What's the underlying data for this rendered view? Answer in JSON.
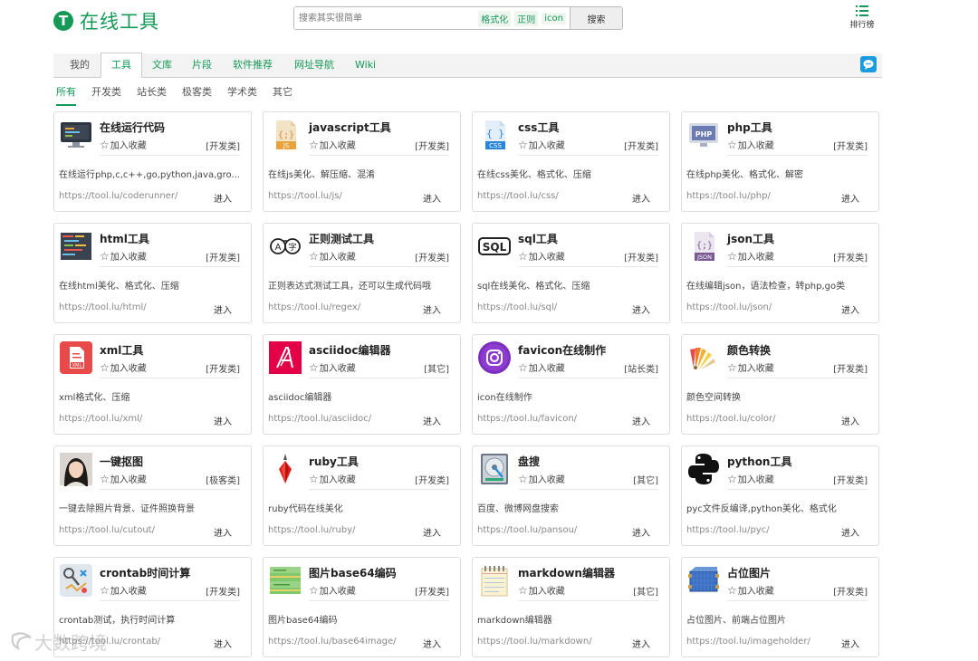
{
  "header": {
    "logo_letter": "T",
    "logo_text": "在线工具",
    "search_placeholder": "搜索其实很简单",
    "search_tags": [
      "格式化",
      "正则",
      "icon"
    ],
    "search_button": "搜索",
    "rank_label": "排行榜"
  },
  "nav": {
    "tabs": [
      "我的",
      "工具",
      "文库",
      "片段",
      "软件推荐",
      "网址导航",
      "Wiki"
    ],
    "active": "工具"
  },
  "subtabs": [
    "所有",
    "开发类",
    "站长类",
    "极客类",
    "学术类",
    "其它"
  ],
  "fav_label": "加入收藏",
  "enter_label": "进入",
  "cards": [
    {
      "title": "在线运行代码",
      "category": "[开发类]",
      "desc": "在线运行php,c,c++,go,python,java,gro...",
      "url": "https://tool.lu/coderunner/",
      "icon": "monitor-code-icon"
    },
    {
      "title": "javascript工具",
      "category": "[开发类]",
      "desc": "在线js美化、解压缩、混淆",
      "url": "https://tool.lu/js/",
      "icon": "js-file-icon"
    },
    {
      "title": "css工具",
      "category": "[开发类]",
      "desc": "在线css美化、格式化、压缩",
      "url": "https://tool.lu/css/",
      "icon": "css-file-icon"
    },
    {
      "title": "php工具",
      "category": "[开发类]",
      "desc": "在线php美化、格式化、解密",
      "url": "https://tool.lu/php/",
      "icon": "php-monitor-icon"
    },
    {
      "title": "html工具",
      "category": "[开发类]",
      "desc": "在线html美化、格式化、压缩",
      "url": "https://tool.lu/html/",
      "icon": "html-code-icon"
    },
    {
      "title": "正则测试工具",
      "category": "[开发类]",
      "desc": "正则表达式测试工具，还可以生成代码哦",
      "url": "https://tool.lu/regex/",
      "icon": "regex-icon"
    },
    {
      "title": "sql工具",
      "category": "[开发类]",
      "desc": "sql在线美化、格式化、压缩",
      "url": "https://tool.lu/sql/",
      "icon": "sql-icon"
    },
    {
      "title": "json工具",
      "category": "[开发类]",
      "desc": "在线编辑json，语法检查，转php,go类",
      "url": "https://tool.lu/json/",
      "icon": "json-file-icon"
    },
    {
      "title": "xml工具",
      "category": "[开发类]",
      "desc": "xml格式化、压缩",
      "url": "https://tool.lu/xml/",
      "icon": "xml-file-icon"
    },
    {
      "title": "asciidoc编辑器",
      "category": "[其它]",
      "desc": "asciidoc编辑器",
      "url": "https://tool.lu/asciidoc/",
      "icon": "asciidoc-icon"
    },
    {
      "title": "favicon在线制作",
      "category": "[站长类]",
      "desc": "icon在线制作",
      "url": "https://tool.lu/favicon/",
      "icon": "instagram-icon"
    },
    {
      "title": "颜色转换",
      "category": "[开发类]",
      "desc": "颜色空间转换",
      "url": "https://tool.lu/color/",
      "icon": "color-swatch-icon"
    },
    {
      "title": "一键抠图",
      "category": "[极客类]",
      "desc": "一键去除照片背景、证件照换背景",
      "url": "https://tool.lu/cutout/",
      "icon": "portrait-photo-icon"
    },
    {
      "title": "ruby工具",
      "category": "[开发类]",
      "desc": "ruby代码在线美化",
      "url": "https://tool.lu/ruby/",
      "icon": "ruby-gem-icon"
    },
    {
      "title": "盘搜",
      "category": "[其它]",
      "desc": "百度、微博网盘搜索",
      "url": "https://tool.lu/pansou/",
      "icon": "hard-disk-icon"
    },
    {
      "title": "python工具",
      "category": "[开发类]",
      "desc": "pyc文件反编译,python美化、格式化",
      "url": "https://tool.lu/pyc/",
      "icon": "python-logo-icon"
    },
    {
      "title": "crontab时间计算",
      "category": "[开发类]",
      "desc": "crontab测试，执行时间计算",
      "url": "https://tool.lu/crontab/",
      "icon": "crontab-tools-icon"
    },
    {
      "title": "图片base64编码",
      "category": "[开发类]",
      "desc": "图片base64编码",
      "url": "https://tool.lu/base64image/",
      "icon": "image-stack-icon"
    },
    {
      "title": "markdown编辑器",
      "category": "[其它]",
      "desc": "markdown编辑器",
      "url": "https://tool.lu/markdown/",
      "icon": "notepad-icon"
    },
    {
      "title": "占位图片",
      "category": "[开发类]",
      "desc": "占位图片、前端占位图片",
      "url": "https://tool.lu/imageholder/",
      "icon": "placeholder-cube-icon"
    }
  ],
  "watermark": "大数跨境"
}
